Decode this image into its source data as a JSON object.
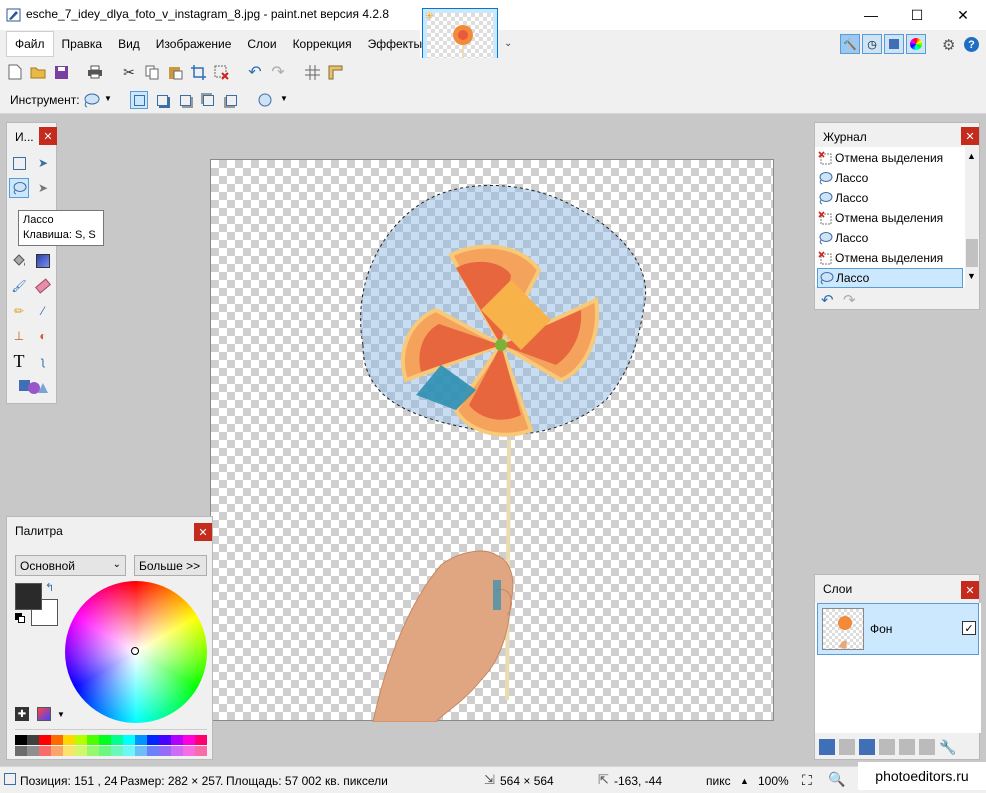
{
  "window": {
    "title": "esche_7_idey_dlya_foto_v_instagram_8.jpg - paint.net версия 4.2.8",
    "minimize": "—",
    "maximize": "☐",
    "close": "✕"
  },
  "menu": {
    "items": [
      "Файл",
      "Правка",
      "Вид",
      "Изображение",
      "Слои",
      "Коррекция",
      "Эффекты"
    ]
  },
  "toolbar": {
    "tool_label": "Инструмент:"
  },
  "tools_panel": {
    "title": "И..."
  },
  "tooltip": {
    "name": "Лассо",
    "shortcut": "Клавиша: S, S"
  },
  "history_panel": {
    "title": "Журнал",
    "items": [
      {
        "label": "Отмена выделения",
        "icon": "deselect-icon"
      },
      {
        "label": "Лассо",
        "icon": "lasso-icon"
      },
      {
        "label": "Лассо",
        "icon": "lasso-icon"
      },
      {
        "label": "Отмена выделения",
        "icon": "deselect-icon"
      },
      {
        "label": "Лассо",
        "icon": "lasso-icon"
      },
      {
        "label": "Отмена выделения",
        "icon": "deselect-icon"
      },
      {
        "label": "Лассо",
        "icon": "lasso-icon",
        "selected": true
      }
    ]
  },
  "palette_panel": {
    "title": "Палитра",
    "mode": "Основной",
    "more_button": "Больше >>",
    "swatches": [
      "#000000",
      "#404040",
      "#ff0000",
      "#ff6a00",
      "#ffd800",
      "#b6ff00",
      "#4cff00",
      "#00ff21",
      "#00ff90",
      "#00ffff",
      "#0094ff",
      "#0026ff",
      "#4800ff",
      "#b200ff",
      "#ff00dc",
      "#ff006e"
    ]
  },
  "layers_panel": {
    "title": "Слои",
    "layers": [
      {
        "name": "Фон",
        "visible": true
      }
    ]
  },
  "status": {
    "position": "Позиция: 151 , 24",
    "size": "Размер: 282 × 257",
    "area": "Площадь: 57 002 кв. пиксели",
    "image_size": "564 × 564",
    "cursor": "-163, -44",
    "units": "пикс",
    "zoom": "100%"
  },
  "watermark": "photoeditors.ru",
  "colors": {
    "accent": "#0078d7",
    "selection": "#cce8ff",
    "close_red": "#c42b1c"
  }
}
